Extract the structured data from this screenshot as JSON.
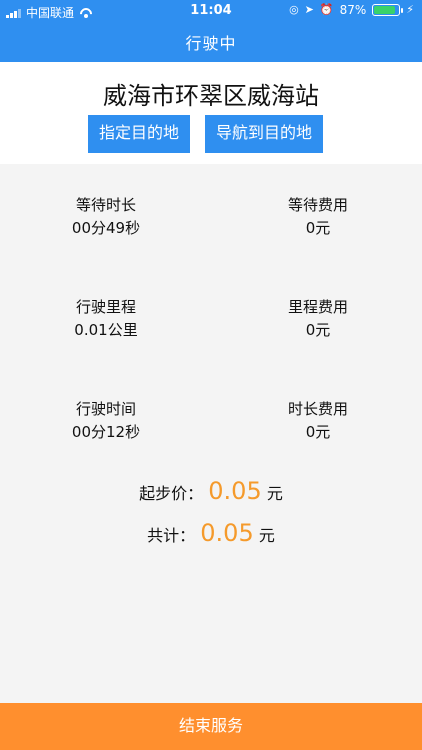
{
  "status_bar": {
    "carrier": "中国联通",
    "time": "11:04",
    "battery": "87%",
    "battery_level": 0.87
  },
  "header": {
    "title": "行驶中"
  },
  "trip": {
    "location": "威海市环翠区威海站",
    "buttons": {
      "set_destination": "指定目的地",
      "navigate": "导航到目的地"
    }
  },
  "metrics": [
    {
      "label": "等待时长",
      "value": "00分49秒"
    },
    {
      "label": "等待费用",
      "value": "0元"
    },
    {
      "label": "行驶里程",
      "value": "0.01公里"
    },
    {
      "label": "里程费用",
      "value": "0元"
    },
    {
      "label": "行驶时间",
      "value": "00分12秒"
    },
    {
      "label": "时长费用",
      "value": "0元"
    }
  ],
  "fares": {
    "base_label": "起步价：",
    "base_value": "0.05",
    "base_unit": "元",
    "total_label": "共计：",
    "total_value": "0.05",
    "total_unit": "元"
  },
  "footer": {
    "end_service": "结束服务"
  },
  "colors": {
    "primary": "#2f8ff0",
    "accent": "#f59a2b",
    "footer": "#ff8f2e",
    "background": "#f4f4f4"
  }
}
